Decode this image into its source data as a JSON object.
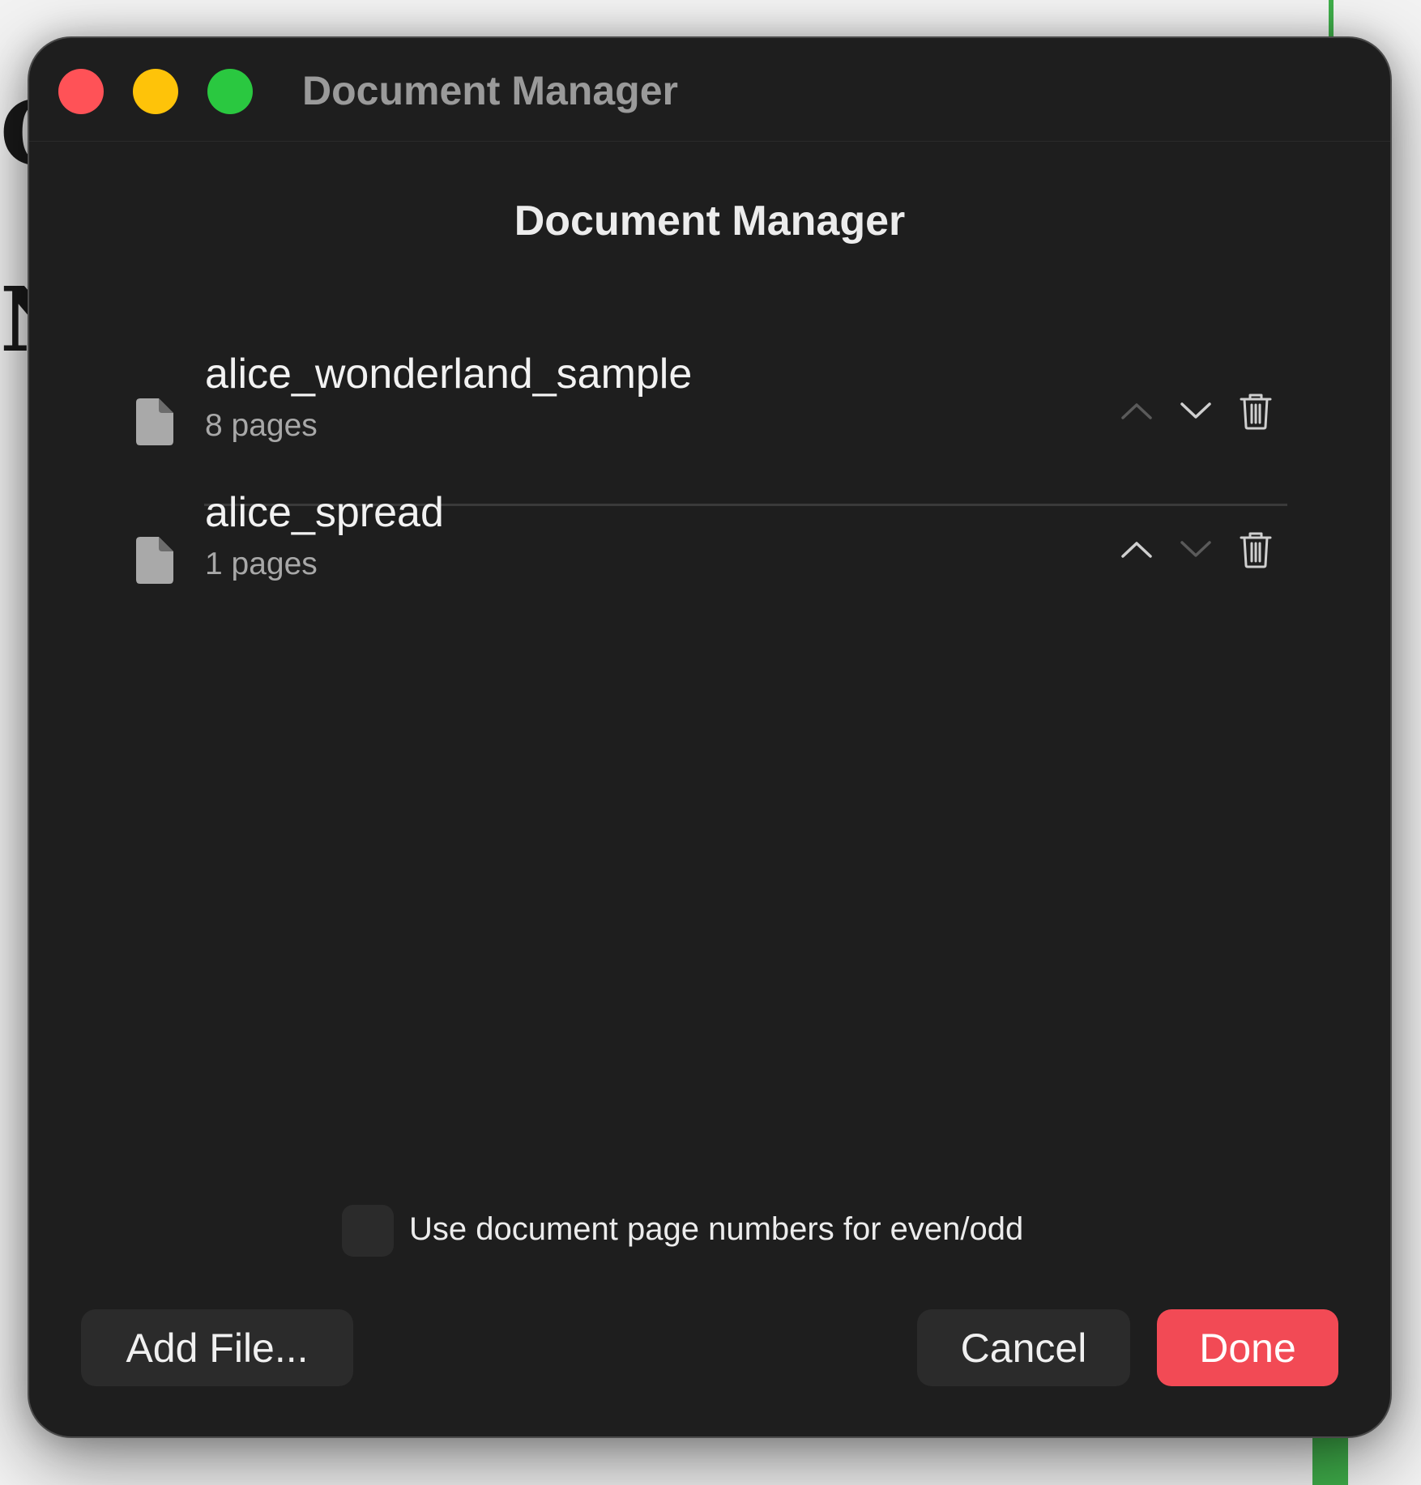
{
  "window": {
    "title": "Document Manager"
  },
  "dialog": {
    "heading": "Document Manager"
  },
  "documents": [
    {
      "name": "alice_wonderland_sample",
      "pages": "8 pages"
    },
    {
      "name": "alice_spread",
      "pages": "1 pages"
    }
  ],
  "options": {
    "even_odd_label": "Use document page numbers for even/odd",
    "even_odd_checked": false
  },
  "buttons": {
    "add_file": "Add File...",
    "cancel": "Cancel",
    "done": "Done"
  },
  "colors": {
    "close": "#ff5257",
    "minimize": "#fec309",
    "zoom": "#2ac840",
    "done_accent": "#f24a55",
    "window_bg": "#1e1e1e"
  },
  "icons": {
    "document": "document-icon",
    "move_up": "chevron-up-icon",
    "move_down": "chevron-down-icon",
    "delete": "trash-icon"
  }
}
